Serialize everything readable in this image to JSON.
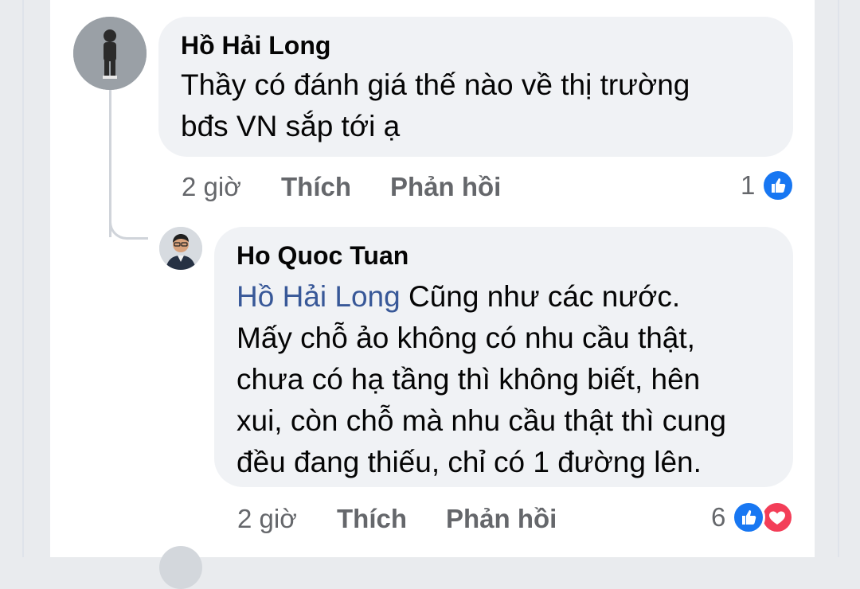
{
  "comment": {
    "author": "Hồ Hải Long",
    "lines": [
      "Thầy có đánh giá thế nào về thị trường",
      "bđs VN sắp tới ạ"
    ],
    "time": "2 giờ",
    "like_label": "Thích",
    "reply_label": "Phản hồi",
    "reaction_count": "1",
    "reactions": [
      "like-icon"
    ]
  },
  "reply": {
    "author": "Ho Quoc Tuan",
    "mention": "Hồ Hải Long",
    "first_line_rest": " Cũng như các nước.",
    "lines": [
      "Mấy chỗ ảo không có nhu cầu thật,",
      "chưa có hạ tầng thì không biết, hên",
      "xui, còn chỗ mà nhu cầu thật thì cung",
      "đều đang thiếu, chỉ có 1 đường lên."
    ],
    "time": "2 giờ",
    "like_label": "Thích",
    "reply_label": "Phản hồi",
    "reaction_count": "6",
    "reactions": [
      "like-icon",
      "love-icon"
    ]
  },
  "colors": {
    "bubble": "#f0f2f5",
    "mention": "#385898",
    "like": "#1877f2",
    "love": "#f33e58",
    "meta": "#65676b"
  }
}
